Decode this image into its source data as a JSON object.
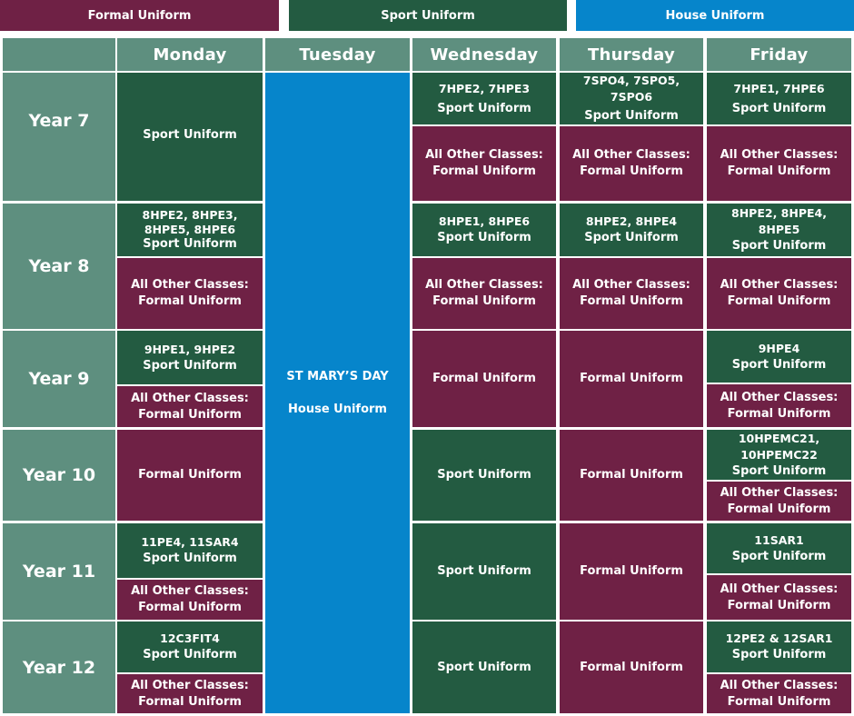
{
  "legend": {
    "formal": "Formal Uniform",
    "sport": "Sport Uniform",
    "house": "House Uniform"
  },
  "colors": {
    "formal": "#6f2145",
    "sport": "#235b41",
    "house": "#0685cb",
    "header": "#5e8f7f"
  },
  "days": [
    "Monday",
    "Tuesday",
    "Wednesday",
    "Thursday",
    "Friday"
  ],
  "years": [
    "Year 7",
    "Year 8",
    "Year 9",
    "Year 10",
    "Year 11",
    "Year 12"
  ],
  "tuesday": {
    "title": "ST MARY’S DAY",
    "label": "House Uniform"
  },
  "labels": {
    "sport": "Sport Uniform",
    "formal": "Formal Uniform",
    "other_1": "All Other Classes:",
    "other_2": "Formal  Uniform"
  },
  "classes": {
    "y7_wed": "7HPE2, 7HPE3",
    "y7_thu": "7SPO4, 7SPO5, 7SPO6",
    "y7_fri": "7HPE1, 7HPE6",
    "y8_mon": "8HPE2, 8HPE3, 8HPE5, 8HPE6",
    "y8_wed": "8HPE1, 8HPE6",
    "y8_thu": "8HPE2, 8HPE4",
    "y8_fri": "8HPE2, 8HPE4, 8HPE5",
    "y9_mon": "9HPE1, 9HPE2",
    "y9_fri": "9HPE4",
    "y10_fri": "10HPEMC21, 10HPEMC22",
    "y11_mon": "11PE4, 11SAR4",
    "y11_fri": "11SAR1",
    "y12_mon": "12C3FIT4",
    "y12_fri": "12PE2 & 12SAR1"
  }
}
